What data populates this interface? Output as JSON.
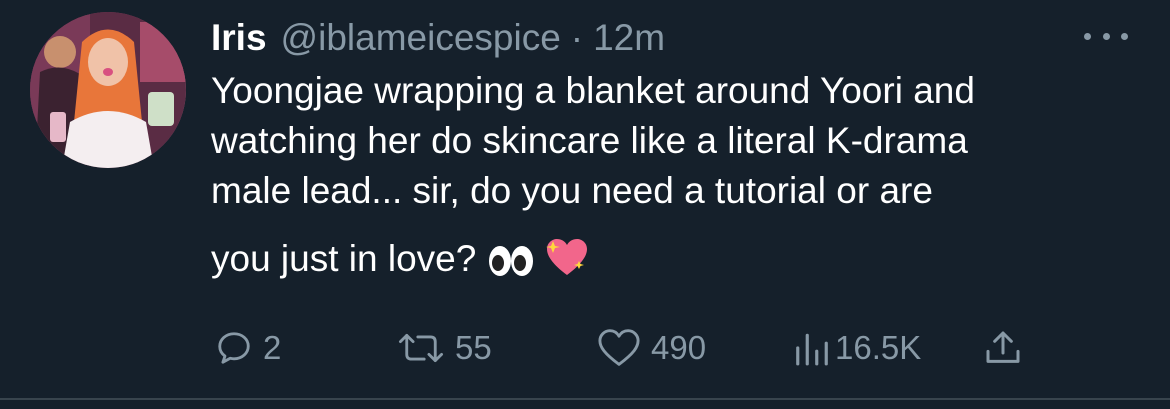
{
  "tweet": {
    "author_name": "Iris",
    "handle": "@iblameicespice",
    "separator": "·",
    "time": "12m",
    "text_lines": [
      "Yoongjae wrapping a blanket around Yoori and",
      "watching her do skincare like a literal K-drama",
      "male lead... sir, do you need a tutorial or are",
      "you just in love?"
    ],
    "emojis": [
      "eyes-emoji",
      "sparkling-heart-emoji"
    ]
  },
  "actions": {
    "reply_count": "2",
    "retweet_count": "55",
    "like_count": "490",
    "views_count": "16.5K"
  },
  "icons": {
    "more": "more-horizontal-icon",
    "reply": "reply-icon",
    "retweet": "retweet-icon",
    "like": "heart-icon",
    "views": "analytics-icon",
    "share": "share-icon"
  },
  "colors": {
    "background": "#15202b",
    "text_primary": "#ffffff",
    "text_secondary": "#8899a6",
    "divider": "#38444d"
  }
}
